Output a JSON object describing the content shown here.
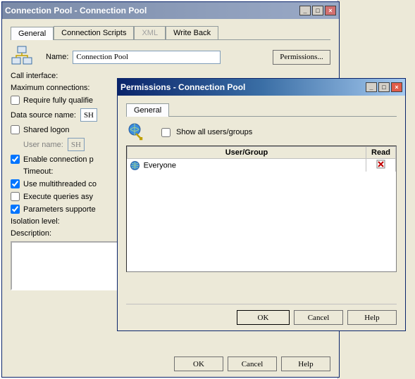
{
  "main": {
    "title": "Connection Pool - Connection Pool",
    "tabs": {
      "general": "General",
      "scripts": "Connection Scripts",
      "xml": "XML",
      "writeback": "Write Back"
    },
    "name_label": "Name:",
    "name_value": "Connection Pool",
    "permissions_btn": "Permissions...",
    "call_interface_label": "Call interface:",
    "max_conn_label": "Maximum connections:",
    "req_qual_label": "Require fully qualifie",
    "dsn_label": "Data source name:",
    "dsn_value": "SH",
    "shared_logon_label": "Shared logon",
    "user_name_label": "User name:",
    "user_name_value": "SH",
    "enable_pool_label": "Enable connection p",
    "timeout_label": "Timeout:",
    "multithread_label": "Use multithreaded co",
    "exec_async_label": "Execute queries asy",
    "params_label": "Parameters supporte",
    "isolation_label": "Isolation level:",
    "description_label": "Description:",
    "ok": "OK",
    "cancel": "Cancel",
    "help": "Help"
  },
  "perm": {
    "title": "Permissions - Connection Pool",
    "tab_general": "General",
    "show_all_label": "Show all users/groups",
    "col_usergroup": "User/Group",
    "col_read": "Read",
    "rows": [
      {
        "name": "Everyone",
        "read": "deny"
      }
    ],
    "ok": "OK",
    "cancel": "Cancel",
    "help": "Help"
  }
}
